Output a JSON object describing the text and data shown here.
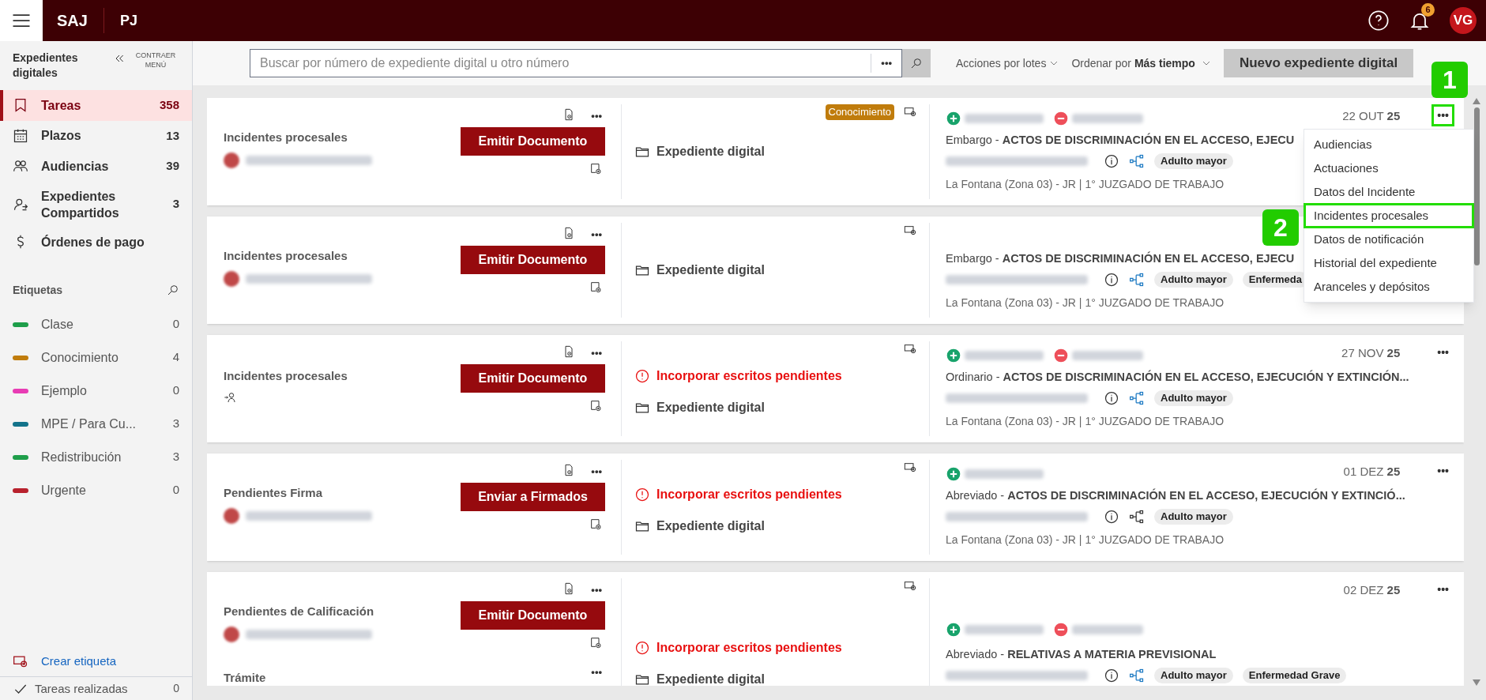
{
  "topbar": {
    "brand": "SAJ",
    "org": "PJ",
    "notifications": "6",
    "avatar": "VG"
  },
  "sidebar": {
    "title": "Expedientes digitales",
    "collapse": "CONTRAER MENÚ",
    "items": [
      {
        "kind": "tasks",
        "label": "Tareas",
        "count": "358",
        "selected": true
      },
      {
        "kind": "calendar",
        "label": "Plazos",
        "count": "13",
        "selected": false
      },
      {
        "kind": "people",
        "label": "Audiencias",
        "count": "39",
        "selected": false
      },
      {
        "kind": "shared",
        "label": "Expedientes Compartidos",
        "count": "3",
        "selected": false
      },
      {
        "kind": "money",
        "label": "Órdenes de pago",
        "selected": false
      }
    ],
    "labels_title": "Etiquetas",
    "labels": [
      {
        "label": "Clase",
        "count": "0",
        "color": "#1e9e4a"
      },
      {
        "label": "Conocimiento",
        "count": "4",
        "color": "#c07c0c"
      },
      {
        "label": "Ejemplo",
        "count": "0",
        "color": "#e83cb4"
      },
      {
        "label": "MPE / Para Cu...",
        "count": "3",
        "color": "#13738a"
      },
      {
        "label": "Redistribución",
        "count": "3",
        "color": "#1e9e4a"
      },
      {
        "label": "Urgente",
        "count": "0",
        "color": "#b8212d"
      }
    ],
    "create_label": "Crear etiqueta",
    "done": {
      "label": "Tareas realizadas",
      "count": "0"
    }
  },
  "toolbar": {
    "search_placeholder": "Buscar por número de expediente digital u otro número",
    "more": "•••",
    "batch": "Acciones por lotes",
    "sort_label": "Ordenar por",
    "sort_value": "Más tiempo",
    "new_button": "Nuevo expediente digital"
  },
  "cards": [
    {
      "tasks": [
        {
          "label": "Incidentes procesales",
          "assigned": true,
          "more": "•••",
          "button": "Emitir Documento"
        }
      ],
      "tag": "Conocimiento",
      "folder": "Expediente digital",
      "parties": [
        {
          "kind": "plus"
        },
        {
          "kind": "minus"
        }
      ],
      "date": "22 OUT",
      "year": "25",
      "title": "Embargo - **ACTOS DE DISCRIMINACIÓN EN EL ACCESO, EJECU**",
      "network_active": true,
      "tags": [
        "Adulto mayor"
      ],
      "court": "La Fontana (Zona 03) - JR | 1° JUZGADO DE TRABAJO",
      "more": "•••",
      "highlighted": true
    },
    {
      "tasks": [
        {
          "label": "Incidentes procesales",
          "assigned": true,
          "more": "•••",
          "button": "Emitir Documento"
        }
      ],
      "folder": "Expediente digital",
      "title": "Embargo - **ACTOS DE DISCRIMINACIÓN EN EL ACCESO, EJECU**",
      "network_active": true,
      "tags": [
        "Adulto mayor",
        "Enfermeda"
      ],
      "court": "La Fontana (Zona 03) - JR | 1° JUZGADO DE TRABAJO"
    },
    {
      "tasks": [
        {
          "label": "Incidentes procesales",
          "assigned": false,
          "more": "•••",
          "button": "Emitir Documento"
        }
      ],
      "warning": "Incorporar escritos pendientes",
      "folder": "Expediente digital",
      "parties": [
        {
          "kind": "plus"
        },
        {
          "kind": "minus"
        }
      ],
      "date": "27 NOV",
      "year": "25",
      "title": "Ordinario - **ACTOS DE DISCRIMINACIÓN EN EL ACCESO, EJECUCIÓN Y EXTINCIÓN...**",
      "network_active": true,
      "tags": [
        "Adulto mayor"
      ],
      "court": "La Fontana (Zona 03) - JR | 1° JUZGADO DE TRABAJO",
      "more": "•••",
      "highlighted": false
    },
    {
      "tasks": [
        {
          "label": "Pendientes Firma",
          "assigned": true,
          "more": "•••",
          "button": "Enviar a Firmados"
        }
      ],
      "warning": "Incorporar escritos pendientes",
      "folder": "Expediente digital",
      "parties": [
        {
          "kind": "plus"
        }
      ],
      "date": "01 DEZ",
      "year": "25",
      "title": "Abreviado - **ACTOS DE DISCRIMINACIÓN EN EL ACCESO, EJECUCIÓN Y EXTINCIÓ...**",
      "network_active": false,
      "tags": [
        "Adulto mayor"
      ],
      "court": "La Fontana (Zona 03) - JR | 1° JUZGADO DE TRABAJO",
      "more": "•••",
      "highlighted": false
    },
    {
      "tasks": [
        {
          "label": "Pendientes de Calificación",
          "assigned": true,
          "more": "•••",
          "button": "Emitir Documento"
        },
        {
          "label": "Trámite",
          "more": "•••"
        }
      ],
      "warning": "Incorporar escritos pendientes",
      "folder": "Expediente digital",
      "parties": [
        {
          "kind": "plus"
        },
        {
          "kind": "minus"
        }
      ],
      "date": "02 DEZ",
      "year": "25",
      "title": "Abreviado - **RELATIVAS A MATERIA PREVISIONAL**",
      "network_active": true,
      "tags": [
        "Adulto mayor",
        "Enfermedad Grave"
      ],
      "more": "•••",
      "highlighted": false
    }
  ],
  "menu": {
    "items": [
      {
        "label": "Audiencias",
        "highlighted": false
      },
      {
        "label": "Actuaciones",
        "highlighted": false
      },
      {
        "label": "Datos del Incidente",
        "highlighted": false
      },
      {
        "label": "Incidentes procesales",
        "highlighted": true
      },
      {
        "label": "Datos de notificación",
        "highlighted": false
      },
      {
        "label": "Historial del expediente",
        "highlighted": false
      },
      {
        "label": "Aranceles y depósitos",
        "highlighted": false
      }
    ]
  },
  "callouts": [
    "1",
    "2"
  ]
}
